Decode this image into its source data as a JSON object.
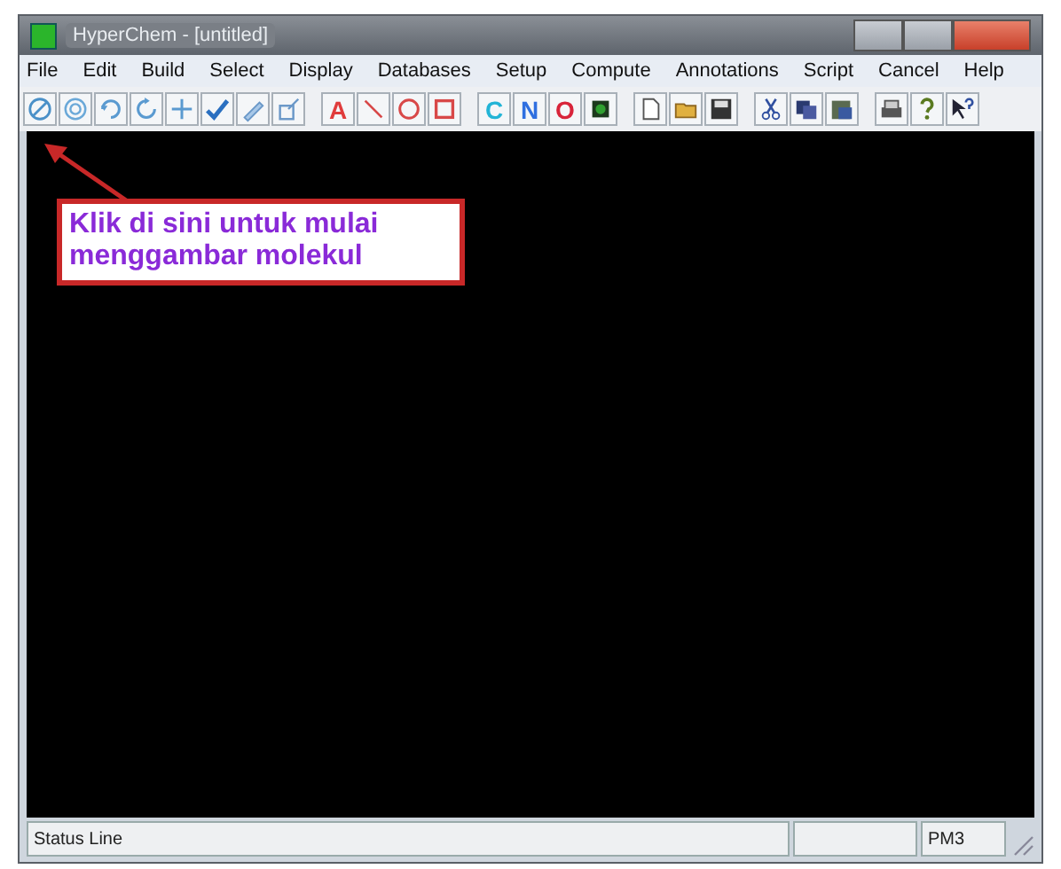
{
  "window": {
    "title": "HyperChem - [untitled]"
  },
  "menu": [
    "File",
    "Edit",
    "Build",
    "Select",
    "Display",
    "Databases",
    "Setup",
    "Compute",
    "Annotations",
    "Script",
    "Cancel",
    "Help"
  ],
  "toolbar_letters": [
    {
      "label": "A",
      "color": "#e03c3c"
    },
    {
      "label": "C",
      "color": "#22b4d6"
    },
    {
      "label": "N",
      "color": "#2f6fe0"
    },
    {
      "label": "O",
      "color": "#d8243a"
    }
  ],
  "callout": {
    "text": "Klik di sini untuk mulai menggambar molekul"
  },
  "status_bar": {
    "message": "Status Line",
    "method": "PM3"
  }
}
